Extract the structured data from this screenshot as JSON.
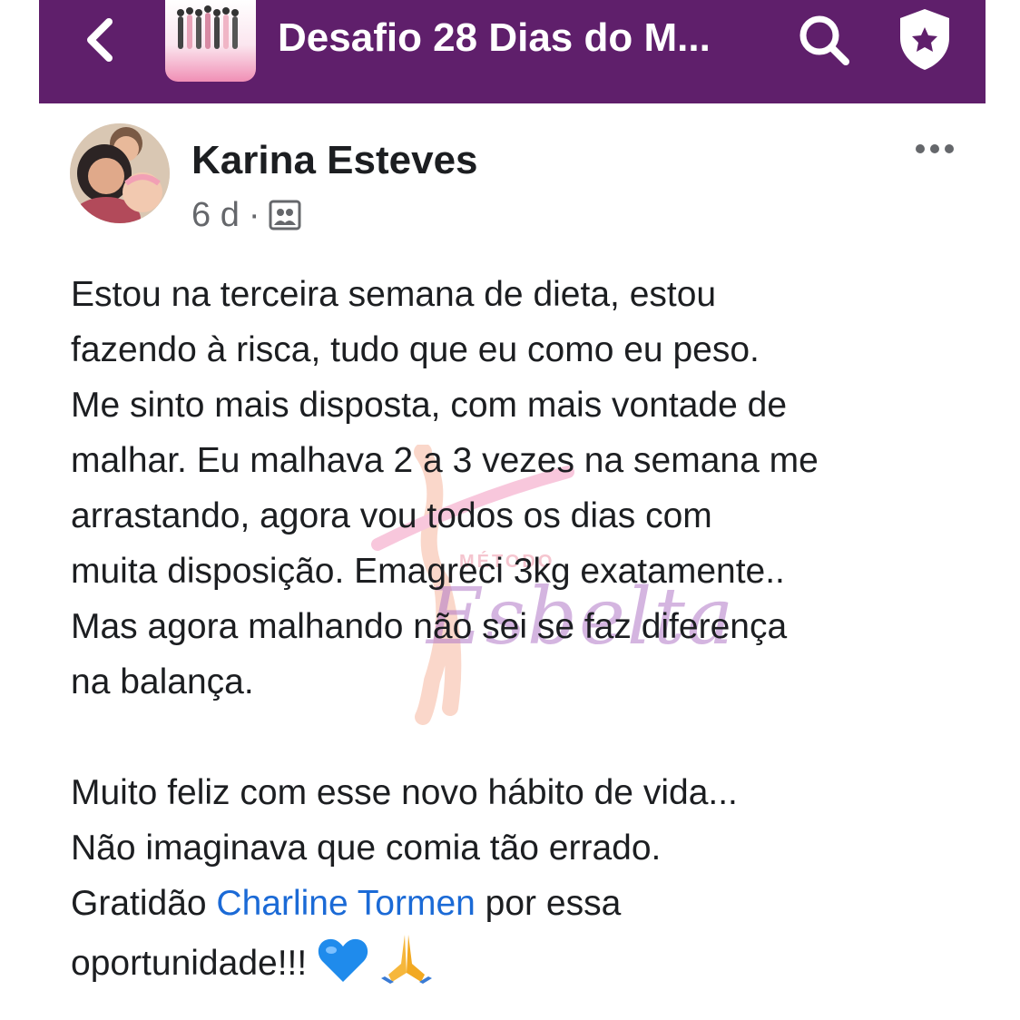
{
  "header": {
    "title": "Desafio 28 Dias do M...",
    "background": "#5f1f6b",
    "icons": [
      "chevron-left-icon",
      "search-icon",
      "shield-star-icon"
    ]
  },
  "post": {
    "author": "Karina Esteves",
    "time": "6 d",
    "separator": "·",
    "audience_icon": "group-audience-icon",
    "paragraph1": [
      "Estou na terceira semana de dieta, estou",
      "fazendo à risca, tudo que eu como eu peso.",
      "Me sinto mais disposta, com mais vontade de",
      "malhar. Eu malhava 2 a 3 vezes na semana me",
      "arrastando, agora vou todos os dias com",
      "muita disposição. Emagreci 3kg exatamente..",
      "Mas agora malhando não sei se faz diferença",
      "na balança."
    ],
    "paragraph2": [
      "Muito feliz com esse novo hábito de vida...",
      "Não imaginava que comia tão errado."
    ],
    "gratitude_prefix": "Gratidão ",
    "mention": "Charline Tormen",
    "gratitude_suffix": " por essa",
    "closing": "oportunidade!!! ",
    "mention_color": "#1b6ad6"
  },
  "watermark": {
    "small_text": "MÉTODO",
    "brand_text": "Esbelta"
  }
}
